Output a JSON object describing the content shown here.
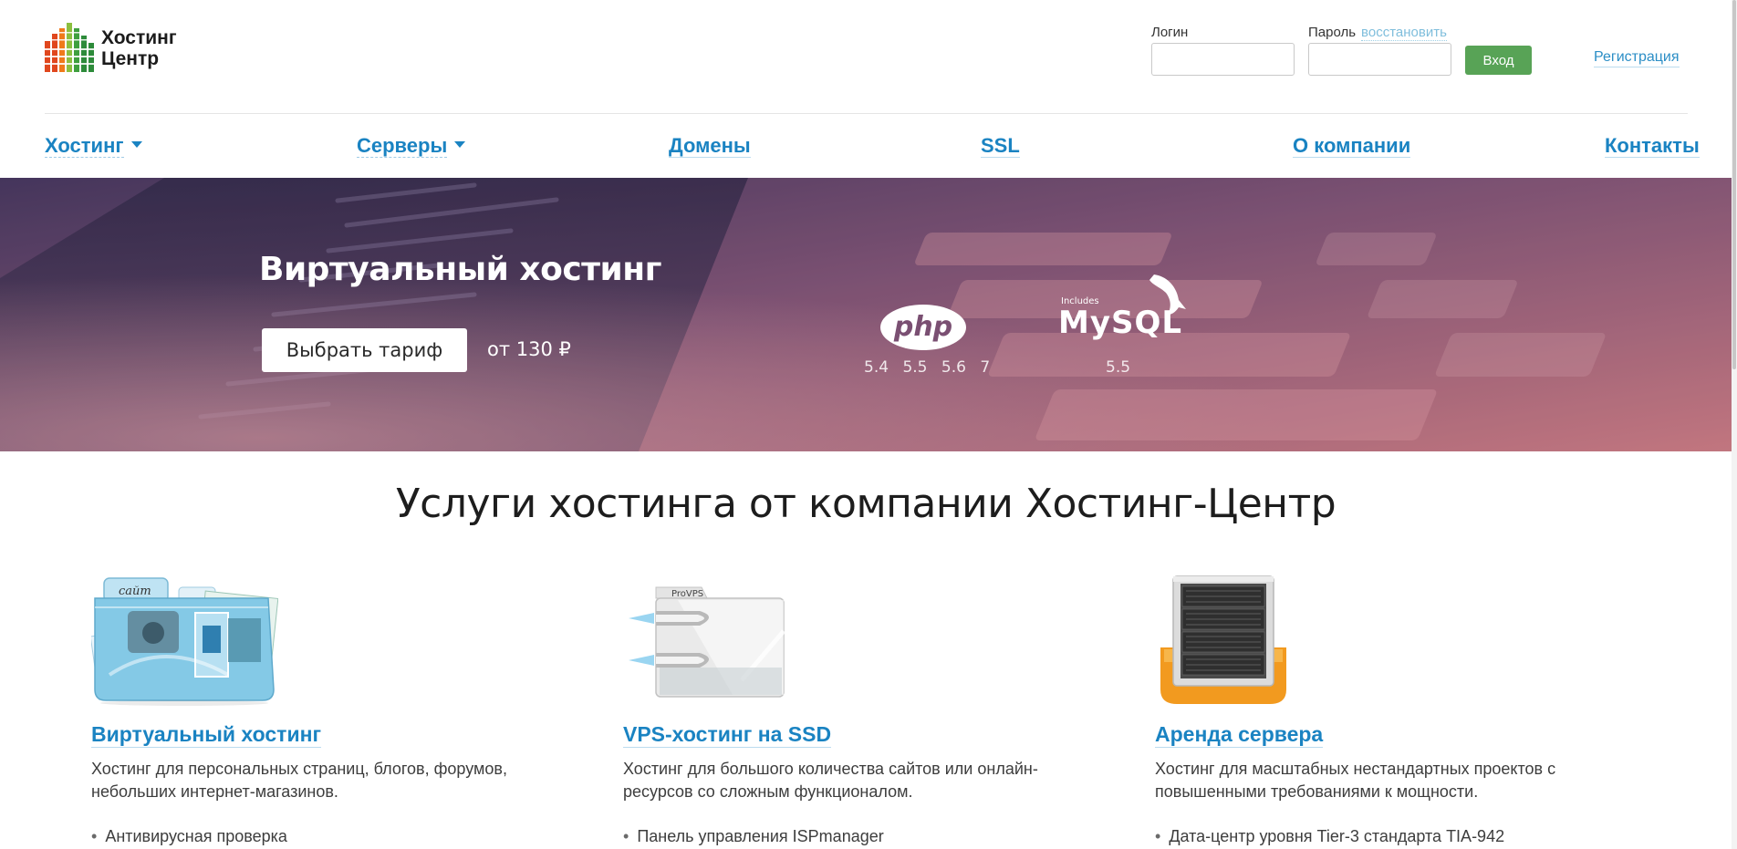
{
  "header": {
    "logo": {
      "line1": "Хостинг",
      "line2": "Центр"
    },
    "login": {
      "login_label": "Логин",
      "password_label": "Пароль",
      "restore_link": "восстановить",
      "login_value": "",
      "password_value": "",
      "submit_label": "Вход",
      "register_link": "Регистрация"
    }
  },
  "nav": {
    "items": [
      {
        "label": "Хостинг",
        "has_dropdown": true
      },
      {
        "label": "Серверы",
        "has_dropdown": true
      },
      {
        "label": "Домены",
        "has_dropdown": false
      },
      {
        "label": "SSL",
        "has_dropdown": false
      },
      {
        "label": "О компании",
        "has_dropdown": false
      },
      {
        "label": "Контакты",
        "has_dropdown": false
      }
    ]
  },
  "banner": {
    "title": "Виртуальный хостинг",
    "button_label": "Выбрать тариф",
    "price_text": "от 130 ₽",
    "php_logo_text": "php",
    "php_versions": "5.4 5.5 5.6 7",
    "mysql_includes": "Includes",
    "mysql_logo_text": "MySQL",
    "mysql_version": "5.5"
  },
  "content": {
    "title": "Услуги хостинга от компании Хостинг-Центр",
    "services": [
      {
        "icon": "folder-website-icon",
        "icon_caption": "сайт",
        "title": "Виртуальный хостинг",
        "description": "Хостинг для персональных страниц, блогов, форумов, небольших интернет-магазинов.",
        "feature": "Антивирусная проверка"
      },
      {
        "icon": "vps-box-icon",
        "icon_caption": "ProVPS",
        "title": "VPS-хостинг на SSD",
        "description": "Хостинг для большого количества сайтов или онлайн-ресурсов со сложным функционалом.",
        "feature": "Панель управления ISPmanager"
      },
      {
        "icon": "server-rack-icon",
        "title": "Аренда сервера",
        "description": "Хостинг для масштабных нестандартных проектов с повышенными требованиями к мощности.",
        "feature": "Дата-центр уровня Tier-3 стандарта TIA-942"
      }
    ]
  },
  "colors": {
    "link_blue": "#1a83c2",
    "button_green": "#58a356",
    "restore_light_blue": "#7fbedc",
    "banner_dark": "#4b3c63",
    "banner_light": "#cf7c86",
    "server_orange": "#f29a1f"
  }
}
